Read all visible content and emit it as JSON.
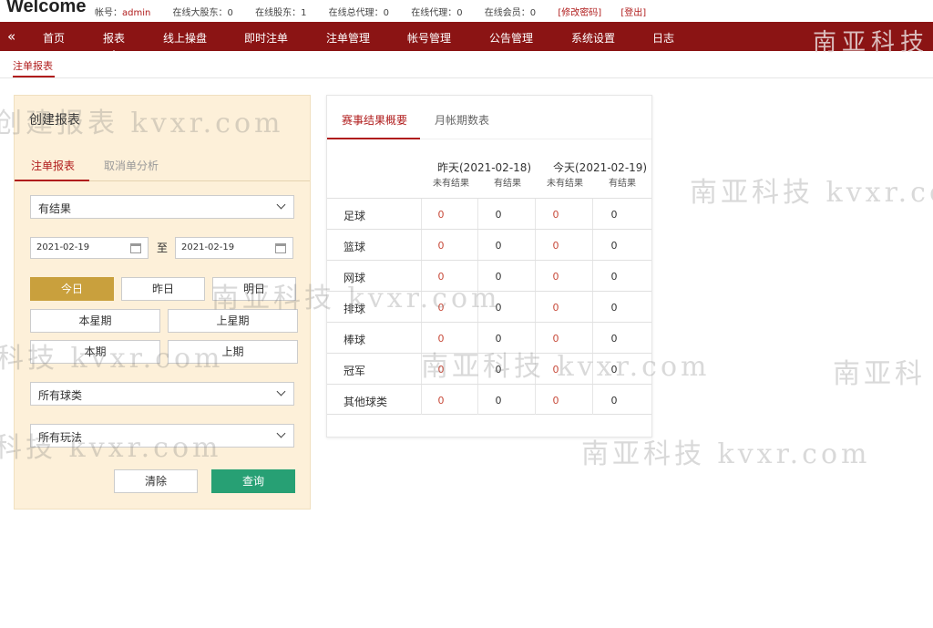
{
  "header": {
    "brand": "Welcome",
    "stats": [
      {
        "label": "帐号：",
        "value": "admin"
      },
      {
        "label": "在线大股东：",
        "value": "0"
      },
      {
        "label": "在线股东：",
        "value": "1"
      },
      {
        "label": "在线总代理：",
        "value": "0"
      },
      {
        "label": "在线代理：",
        "value": "0"
      },
      {
        "label": "在线会员：",
        "value": "0"
      }
    ],
    "links": [
      "[修改密码]",
      "[登出]"
    ]
  },
  "nav": {
    "collapse_glyph": "«",
    "items": [
      "首页",
      "报表",
      "线上操盘",
      "即时注单",
      "注单管理",
      "帐号管理",
      "公告管理",
      "系统设置",
      "日志"
    ],
    "active": "报表",
    "logo_text": "南亚科技"
  },
  "breadcrumb": "注单报表",
  "panel": {
    "title": "创建报表",
    "tabs": [
      "注单报表",
      "取消单分析"
    ],
    "result_select": "有结果",
    "date_from": "2021-02-19",
    "date_to": "2021-02-19",
    "date_sep": "至",
    "quick_buttons_row1": [
      "今日",
      "昨日",
      "明日"
    ],
    "quick_buttons_row2": [
      "本星期",
      "上星期"
    ],
    "quick_buttons_row3": [
      "本期",
      "上期"
    ],
    "sport_select": "所有球类",
    "play_select": "所有玩法",
    "clear_label": "清除",
    "query_label": "查询"
  },
  "card": {
    "tabs": [
      "赛事结果概要",
      "月帐期数表"
    ],
    "days": [
      {
        "label": "昨天(2021-02-18)",
        "sub": [
          "未有结果",
          "有结果"
        ]
      },
      {
        "label": "今天(2021-02-19)",
        "sub": [
          "未有结果",
          "有结果"
        ]
      }
    ],
    "rows": [
      {
        "sport": "足球",
        "values": [
          "0",
          "0",
          "0",
          "0"
        ]
      },
      {
        "sport": "篮球",
        "values": [
          "0",
          "0",
          "0",
          "0"
        ]
      },
      {
        "sport": "网球",
        "values": [
          "0",
          "0",
          "0",
          "0"
        ]
      },
      {
        "sport": "排球",
        "values": [
          "0",
          "0",
          "0",
          "0"
        ]
      },
      {
        "sport": "棒球",
        "values": [
          "0",
          "0",
          "0",
          "0"
        ]
      },
      {
        "sport": "冠军",
        "values": [
          "0",
          "0",
          "0",
          "0"
        ]
      },
      {
        "sport": "其他球类",
        "values": [
          "0",
          "0",
          "0",
          "0"
        ]
      }
    ]
  },
  "watermark": {
    "text": "南亚科技 kvxr.com",
    "fragment_left": "科技 kvxr.com",
    "fragment_right": "南亚科",
    "fragment_top_left": "创建报表 kvxr.com"
  },
  "colors": {
    "nav_bg": "#8b1414",
    "accent_red": "#b01c1c",
    "panel_bg": "#fdf0d9",
    "today_btn": "#c9a03d",
    "query_btn": "#27a074"
  }
}
